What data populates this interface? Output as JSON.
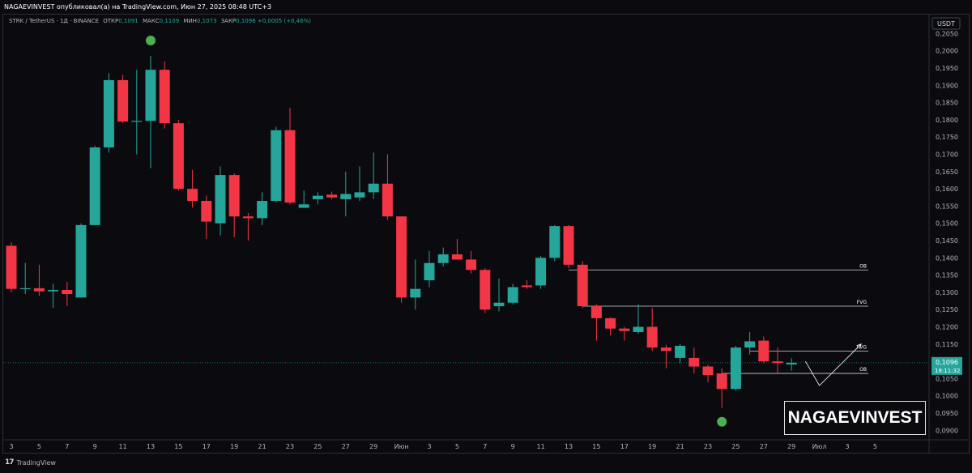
{
  "header": {
    "publish_line": "NAGAEVINVEST опубликовал(а) на TradingView.com, Июн 27, 2025 08:48 UTC+3"
  },
  "legend": {
    "symbol": "STRK / TetherUS · 1Д · BINANCE",
    "open_label": "ОТКР",
    "open": "0,1091",
    "high_label": "МАКС",
    "high": "0,1109",
    "low_label": "МИН",
    "low": "0,1073",
    "close_label": "ЗАКР",
    "close": "0,1096",
    "change": "+0,0005 (+0,46%)"
  },
  "footer": {
    "brand": "TradingView"
  },
  "watermark": "NAGAEVINVEST",
  "colors": {
    "up": "#26a69a",
    "down": "#f23645",
    "background": "#0b0b0f",
    "axis_text": "#b2b5be",
    "level_line": "#d1d4dc",
    "marker": "#4caf50"
  },
  "chart_data": {
    "type": "candlestick",
    "currency": "USDT",
    "ylim": [
      0.0875,
      0.2105
    ],
    "y_ticks": [
      "0,0900",
      "0,0950",
      "0,1000",
      "0,1050",
      "0,1100",
      "0,1150",
      "0,1200",
      "0,1250",
      "0,1300",
      "0,1350",
      "0,1400",
      "0,1450",
      "0,1500",
      "0,1550",
      "0,1600",
      "0,1650",
      "0,1700",
      "0,1750",
      "0,1800",
      "0,1850",
      "0,1900",
      "0,1950",
      "0,2000",
      "0,2050"
    ],
    "x_ticks": [
      "3",
      "5",
      "7",
      "9",
      "11",
      "13",
      "15",
      "17",
      "19",
      "21",
      "23",
      "25",
      "27",
      "29",
      "Июн",
      "3",
      "5",
      "7",
      "9",
      "11",
      "13",
      "15",
      "17",
      "19",
      "21",
      "23",
      "25",
      "27",
      "29",
      "Июл",
      "3",
      "5"
    ],
    "candles": [
      {
        "o": 0.1435,
        "h": 0.1445,
        "l": 0.13,
        "c": 0.131
      },
      {
        "o": 0.131,
        "h": 0.1385,
        "l": 0.1295,
        "c": 0.1312
      },
      {
        "o": 0.1312,
        "h": 0.138,
        "l": 0.129,
        "c": 0.1303
      },
      {
        "o": 0.1303,
        "h": 0.1325,
        "l": 0.1255,
        "c": 0.1307
      },
      {
        "o": 0.1307,
        "h": 0.133,
        "l": 0.126,
        "c": 0.1295
      },
      {
        "o": 0.1285,
        "h": 0.15,
        "l": 0.1285,
        "c": 0.1495
      },
      {
        "o": 0.1495,
        "h": 0.1725,
        "l": 0.1495,
        "c": 0.172
      },
      {
        "o": 0.172,
        "h": 0.1935,
        "l": 0.1705,
        "c": 0.1915
      },
      {
        "o": 0.1915,
        "h": 0.193,
        "l": 0.179,
        "c": 0.1795
      },
      {
        "o": 0.1795,
        "h": 0.1945,
        "l": 0.17,
        "c": 0.1797
      },
      {
        "o": 0.1797,
        "h": 0.1985,
        "l": 0.166,
        "c": 0.1945
      },
      {
        "o": 0.1945,
        "h": 0.197,
        "l": 0.1775,
        "c": 0.179
      },
      {
        "o": 0.179,
        "h": 0.18,
        "l": 0.1595,
        "c": 0.16
      },
      {
        "o": 0.16,
        "h": 0.1655,
        "l": 0.1545,
        "c": 0.1565
      },
      {
        "o": 0.1565,
        "h": 0.158,
        "l": 0.1455,
        "c": 0.1505
      },
      {
        "o": 0.15,
        "h": 0.1665,
        "l": 0.1465,
        "c": 0.164
      },
      {
        "o": 0.164,
        "h": 0.1645,
        "l": 0.146,
        "c": 0.152
      },
      {
        "o": 0.152,
        "h": 0.153,
        "l": 0.145,
        "c": 0.1515
      },
      {
        "o": 0.1515,
        "h": 0.159,
        "l": 0.1495,
        "c": 0.1565
      },
      {
        "o": 0.1565,
        "h": 0.178,
        "l": 0.156,
        "c": 0.177
      },
      {
        "o": 0.177,
        "h": 0.1835,
        "l": 0.1555,
        "c": 0.156
      },
      {
        "o": 0.1545,
        "h": 0.1595,
        "l": 0.1545,
        "c": 0.1555
      },
      {
        "o": 0.157,
        "h": 0.159,
        "l": 0.1555,
        "c": 0.158
      },
      {
        "o": 0.1583,
        "h": 0.1592,
        "l": 0.157,
        "c": 0.1575
      },
      {
        "o": 0.157,
        "h": 0.165,
        "l": 0.152,
        "c": 0.1585
      },
      {
        "o": 0.1575,
        "h": 0.1665,
        "l": 0.1565,
        "c": 0.159
      },
      {
        "o": 0.159,
        "h": 0.1705,
        "l": 0.157,
        "c": 0.1615
      },
      {
        "o": 0.1615,
        "h": 0.17,
        "l": 0.151,
        "c": 0.152
      },
      {
        "o": 0.152,
        "h": 0.152,
        "l": 0.127,
        "c": 0.1285
      },
      {
        "o": 0.1285,
        "h": 0.1395,
        "l": 0.125,
        "c": 0.131
      },
      {
        "o": 0.1335,
        "h": 0.142,
        "l": 0.1315,
        "c": 0.1385
      },
      {
        "o": 0.1385,
        "h": 0.143,
        "l": 0.1375,
        "c": 0.141
      },
      {
        "o": 0.141,
        "h": 0.1455,
        "l": 0.1395,
        "c": 0.1395
      },
      {
        "o": 0.1395,
        "h": 0.142,
        "l": 0.1355,
        "c": 0.1365
      },
      {
        "o": 0.1365,
        "h": 0.137,
        "l": 0.124,
        "c": 0.125
      },
      {
        "o": 0.126,
        "h": 0.134,
        "l": 0.1245,
        "c": 0.127
      },
      {
        "o": 0.127,
        "h": 0.1325,
        "l": 0.1265,
        "c": 0.1315
      },
      {
        "o": 0.132,
        "h": 0.1335,
        "l": 0.131,
        "c": 0.1315
      },
      {
        "o": 0.132,
        "h": 0.1405,
        "l": 0.131,
        "c": 0.14
      },
      {
        "o": 0.14,
        "h": 0.1495,
        "l": 0.139,
        "c": 0.1492
      },
      {
        "o": 0.1492,
        "h": 0.1495,
        "l": 0.137,
        "c": 0.138
      },
      {
        "o": 0.138,
        "h": 0.139,
        "l": 0.1255,
        "c": 0.126
      },
      {
        "o": 0.126,
        "h": 0.1265,
        "l": 0.116,
        "c": 0.1225
      },
      {
        "o": 0.1225,
        "h": 0.1228,
        "l": 0.1175,
        "c": 0.1195
      },
      {
        "o": 0.1195,
        "h": 0.12,
        "l": 0.116,
        "c": 0.1188
      },
      {
        "o": 0.1185,
        "h": 0.1265,
        "l": 0.118,
        "c": 0.12
      },
      {
        "o": 0.12,
        "h": 0.1255,
        "l": 0.113,
        "c": 0.114
      },
      {
        "o": 0.114,
        "h": 0.1148,
        "l": 0.108,
        "c": 0.113
      },
      {
        "o": 0.111,
        "h": 0.115,
        "l": 0.1095,
        "c": 0.1145
      },
      {
        "o": 0.111,
        "h": 0.114,
        "l": 0.1065,
        "c": 0.1085
      },
      {
        "o": 0.1085,
        "h": 0.109,
        "l": 0.104,
        "c": 0.106
      },
      {
        "o": 0.1065,
        "h": 0.108,
        "l": 0.0965,
        "c": 0.102
      },
      {
        "o": 0.102,
        "h": 0.1145,
        "l": 0.1015,
        "c": 0.114
      },
      {
        "o": 0.114,
        "h": 0.1185,
        "l": 0.112,
        "c": 0.1158
      },
      {
        "o": 0.116,
        "h": 0.1172,
        "l": 0.1095,
        "c": 0.11
      },
      {
        "o": 0.11,
        "h": 0.114,
        "l": 0.1065,
        "c": 0.1095
      },
      {
        "o": 0.1091,
        "h": 0.1109,
        "l": 0.1073,
        "c": 0.1096
      }
    ],
    "levels": [
      {
        "label": "OB",
        "price": 0.1365,
        "from_index": 40
      },
      {
        "label": "FVG",
        "price": 0.126,
        "from_index": 41
      },
      {
        "label": "FVG",
        "price": 0.113,
        "from_index": 53
      },
      {
        "label": "OB",
        "price": 0.1065,
        "from_index": 51
      }
    ],
    "markers": [
      {
        "index": 10,
        "price": 0.203,
        "type": "high"
      },
      {
        "index": 51,
        "price": 0.0925,
        "type": "low"
      }
    ],
    "projection": [
      {
        "index": 57,
        "price": 0.11
      },
      {
        "index": 58,
        "price": 0.103
      },
      {
        "index": 61,
        "price": 0.115
      }
    ],
    "last_price": {
      "value": "0,1096",
      "price": 0.1096,
      "countdown": "18:11:32"
    }
  }
}
